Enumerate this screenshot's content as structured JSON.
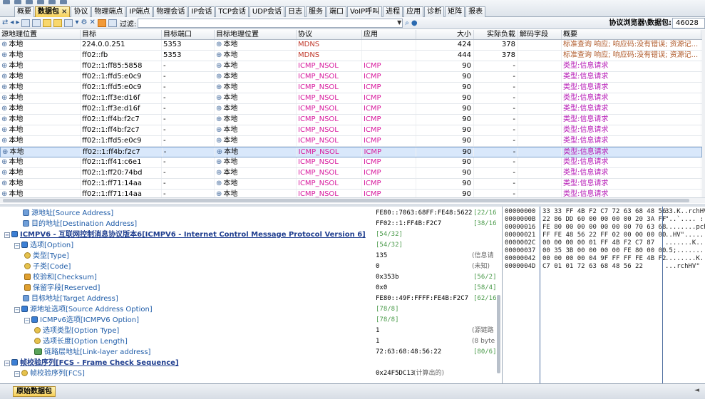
{
  "tabs": [
    "概要",
    "数据包",
    "协议",
    "物理端点",
    "IP端点",
    "物理会话",
    "IP会话",
    "TCP会话",
    "UDP会话",
    "日志",
    "服务",
    "端口",
    "VoIP呼叫",
    "进程",
    "应用",
    "诊断",
    "矩阵",
    "报表"
  ],
  "tab_close": "×",
  "toolbar": {
    "filter_label": "过滤:",
    "browse_label": "协议浏览器\\数据包:",
    "browse_value": "46028"
  },
  "grid": {
    "headers": [
      "源地理位置",
      "目标",
      "目标端口",
      "目标地理位置",
      "协议",
      "应用",
      "大小",
      "实际负载",
      "解码字段",
      "概要"
    ],
    "rows": [
      [
        "本地",
        "224.0.0.251",
        "5353",
        "本地",
        "MDNS",
        "",
        "424",
        "378",
        "",
        "标准查询 响应; 响应码:没有错误; 资源记..."
      ],
      [
        "本地",
        "ff02::fb",
        "5353",
        "本地",
        "MDNS",
        "",
        "444",
        "378",
        "",
        "标准查询 响应; 响应码:没有错误; 资源记..."
      ],
      [
        "本地",
        "ff02::1:ff85:5858",
        "-",
        "本地",
        "ICMP_NSOL",
        "ICMP",
        "90",
        "-",
        "",
        "类型:信息请求"
      ],
      [
        "本地",
        "ff02::1:ffd5:e0c9",
        "-",
        "本地",
        "ICMP_NSOL",
        "ICMP",
        "90",
        "-",
        "",
        "类型:信息请求"
      ],
      [
        "本地",
        "ff02::1:ffd5:e0c9",
        "-",
        "本地",
        "ICMP_NSOL",
        "ICMP",
        "90",
        "-",
        "",
        "类型:信息请求"
      ],
      [
        "本地",
        "ff02::1:ff3e:d16f",
        "-",
        "本地",
        "ICMP_NSOL",
        "ICMP",
        "90",
        "-",
        "",
        "类型:信息请求"
      ],
      [
        "本地",
        "ff02::1:ff3e:d16f",
        "-",
        "本地",
        "ICMP_NSOL",
        "ICMP",
        "90",
        "-",
        "",
        "类型:信息请求"
      ],
      [
        "本地",
        "ff02::1:ff4b:f2c7",
        "-",
        "本地",
        "ICMP_NSOL",
        "ICMP",
        "90",
        "-",
        "",
        "类型:信息请求"
      ],
      [
        "本地",
        "ff02::1:ff4b:f2c7",
        "-",
        "本地",
        "ICMP_NSOL",
        "ICMP",
        "90",
        "-",
        "",
        "类型:信息请求"
      ],
      [
        "本地",
        "ff02::1:ffd5:e0c9",
        "-",
        "本地",
        "ICMP_NSOL",
        "ICMP",
        "90",
        "-",
        "",
        "类型:信息请求"
      ],
      [
        "本地",
        "ff02::1:ff4b:f2c7",
        "-",
        "本地",
        "ICMP_NSOL",
        "ICMP",
        "90",
        "-",
        "",
        "类型:信息请求"
      ],
      [
        "本地",
        "ff02::1:ff41:c6e1",
        "-",
        "本地",
        "ICMP_NSOL",
        "ICMP",
        "90",
        "-",
        "",
        "类型:信息请求"
      ],
      [
        "本地",
        "ff02::1:ff20:74bd",
        "-",
        "本地",
        "ICMP_NSOL",
        "ICMP",
        "90",
        "-",
        "",
        "类型:信息请求"
      ],
      [
        "本地",
        "ff02::1:ff71:14aa",
        "-",
        "本地",
        "ICMP_NSOL",
        "ICMP",
        "90",
        "-",
        "",
        "类型:信息请求"
      ],
      [
        "本地",
        "ff02::1:ff71:14aa",
        "-",
        "本地",
        "ICMP_NSOL",
        "ICMP",
        "90",
        "-",
        "",
        "类型:信息请求"
      ]
    ]
  },
  "tree": [
    {
      "label": "源地址[Source Address]",
      "value": "FE80::7063:68FF:FE48:5622",
      "off": "[22/16",
      "note": ""
    },
    {
      "label": "目的地址[Destination Address]",
      "value": "FF02::1:FF4B:F2C7",
      "off": "[38/16",
      "note": ""
    },
    {
      "label": "ICMPV6 - 互联网控制消息协议版本6[ICMPV6 - Internet Control Message Protocol Version 6]",
      "value": "[54/32]",
      "off": "",
      "note": ""
    },
    {
      "label": "选项[Option]",
      "value": "[54/32]",
      "off": "",
      "note": ""
    },
    {
      "label": "类型[Type]",
      "value": "135",
      "off": "",
      "note": "(信息请"
    },
    {
      "label": "子类[Code]",
      "value": "0",
      "off": "",
      "note": "(未知)"
    },
    {
      "label": "校验和[Checksum]",
      "value": "0x353b",
      "off": "[56/2]",
      "note": ""
    },
    {
      "label": "保留字段[Reserved]",
      "value": "0x0",
      "off": "[58/4]",
      "note": ""
    },
    {
      "label": "目标地址[Target Address]",
      "value": "FE80::49F:FFFF:FE4B:F2C7",
      "off": "[62/16]",
      "note": ""
    },
    {
      "label": "源地址选项[Source Address Option]",
      "value": "[78/8]",
      "off": "",
      "note": ""
    },
    {
      "label": "ICMPv6选项[ICMPV6 Option]",
      "value": "[78/8]",
      "off": "",
      "note": ""
    },
    {
      "label": "选项类型[Option Type]",
      "value": "1",
      "off": "",
      "note": "(源链路"
    },
    {
      "label": "选项长度[Option Length]",
      "value": "1",
      "off": "",
      "note": "(8 byte"
    },
    {
      "label": "链路层地址[Link-layer address]",
      "value": "72:63:68:48:56:22",
      "off": "[80/6]",
      "note": ""
    },
    {
      "label": "帧校验序列[FCS - Frame Check Sequence]",
      "value": "",
      "off": "",
      "note": ""
    },
    {
      "label": "帧校验序列[FCS]",
      "value": "0x24F5DC13",
      "off": "",
      "note": "(计算出的)"
    }
  ],
  "hex": [
    {
      "addr": "00000000",
      "bytes": "33 33 FF 4B F2 C7 72 63 68 48 56",
      "text": "33.K..rchHV"
    },
    {
      "addr": "0000000B",
      "bytes": "22 86 DD 60 00 00 00 00 20 3A FF",
      "text": "\"..`.... :."
    },
    {
      "addr": "00000016",
      "bytes": "FE 80 00 00 00 00 00 00 70 63 68",
      "text": "........pch"
    },
    {
      "addr": "00000021",
      "bytes": "FF FE 48 56 22 FF 02 00 00 00 00",
      "text": "..HV\"......"
    },
    {
      "addr": "0000002C",
      "bytes": "00 00 00 00 01 FF 4B F2 C7 87",
      "text": ".......K..."
    },
    {
      "addr": "00000037",
      "bytes": "00 35 3B 00 00 00 00 FE 80 00 00",
      "text": ".5;........"
    },
    {
      "addr": "00000042",
      "bytes": "00 00 00 00 04 9F FF FF FE 4B F2",
      "text": "........K.."
    },
    {
      "addr": "0000004D",
      "bytes": "C7 01 01 72 63 68 48 56 22",
      "text": "...rchHV\""
    }
  ],
  "bottom": {
    "tab": "原始数据包",
    "marker": "◄"
  }
}
